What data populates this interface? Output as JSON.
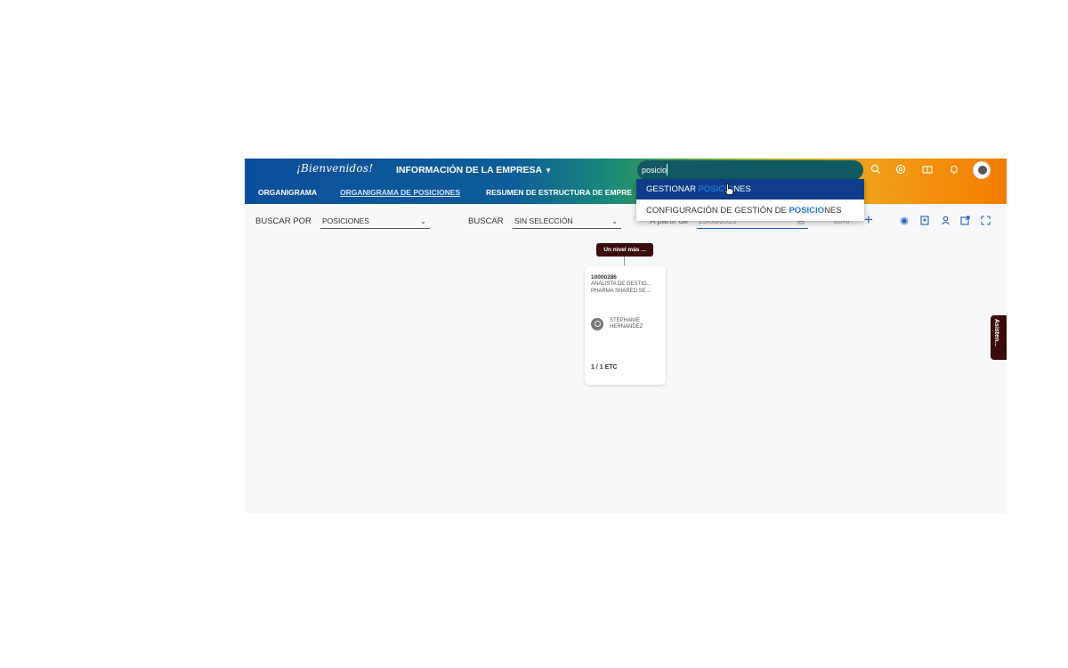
{
  "header": {
    "welcome": "¡Bienvenidos!",
    "menu_title": "INFORMACIÓN DE LA EMPRESA",
    "tabs": [
      {
        "label": "ORGANIGRAMA"
      },
      {
        "label": "ORGANIGRAMA DE POSICIONES",
        "active": true
      },
      {
        "label": "RESUMEN DE ESTRUCTURA DE EMPRE"
      }
    ],
    "search_value": "posicio",
    "icons": [
      "search-icon",
      "help-icon",
      "book-icon",
      "bell-icon",
      "avatar"
    ]
  },
  "search_results": [
    {
      "pre": "GESTIONAR ",
      "match": "POSICIO",
      "post": "NES"
    },
    {
      "pre": "CONFIGURACIÓN DE GESTIÓN DE ",
      "match": "POSICIO",
      "post": "NES"
    }
  ],
  "toolbar": {
    "buscar_por_label": "BUSCAR POR",
    "buscar_por_value": "POSICIONES",
    "buscar_label": "BUSCAR",
    "buscar_value": "SIN SELECCIÓN",
    "date_label": "A partir de",
    "date_value": "25/06/2025",
    "zoom": "80%"
  },
  "chart": {
    "level_label": "Un nivel más ...",
    "card": {
      "code": "10000286",
      "title": "ANALISTA DE GESTIO...",
      "org": "PHARMA SHARED SE...",
      "holder_first": "STEPHANIE",
      "holder_last": "HERNANDEZ",
      "fte": "1 / 1 ETC"
    }
  },
  "side_tab": "Asisten...",
  "colors": {
    "header_blue": "#0b4f9c",
    "header_orange": "#f57c00",
    "accent": "#1f5fbf",
    "highlight": "#0f3c8a"
  }
}
